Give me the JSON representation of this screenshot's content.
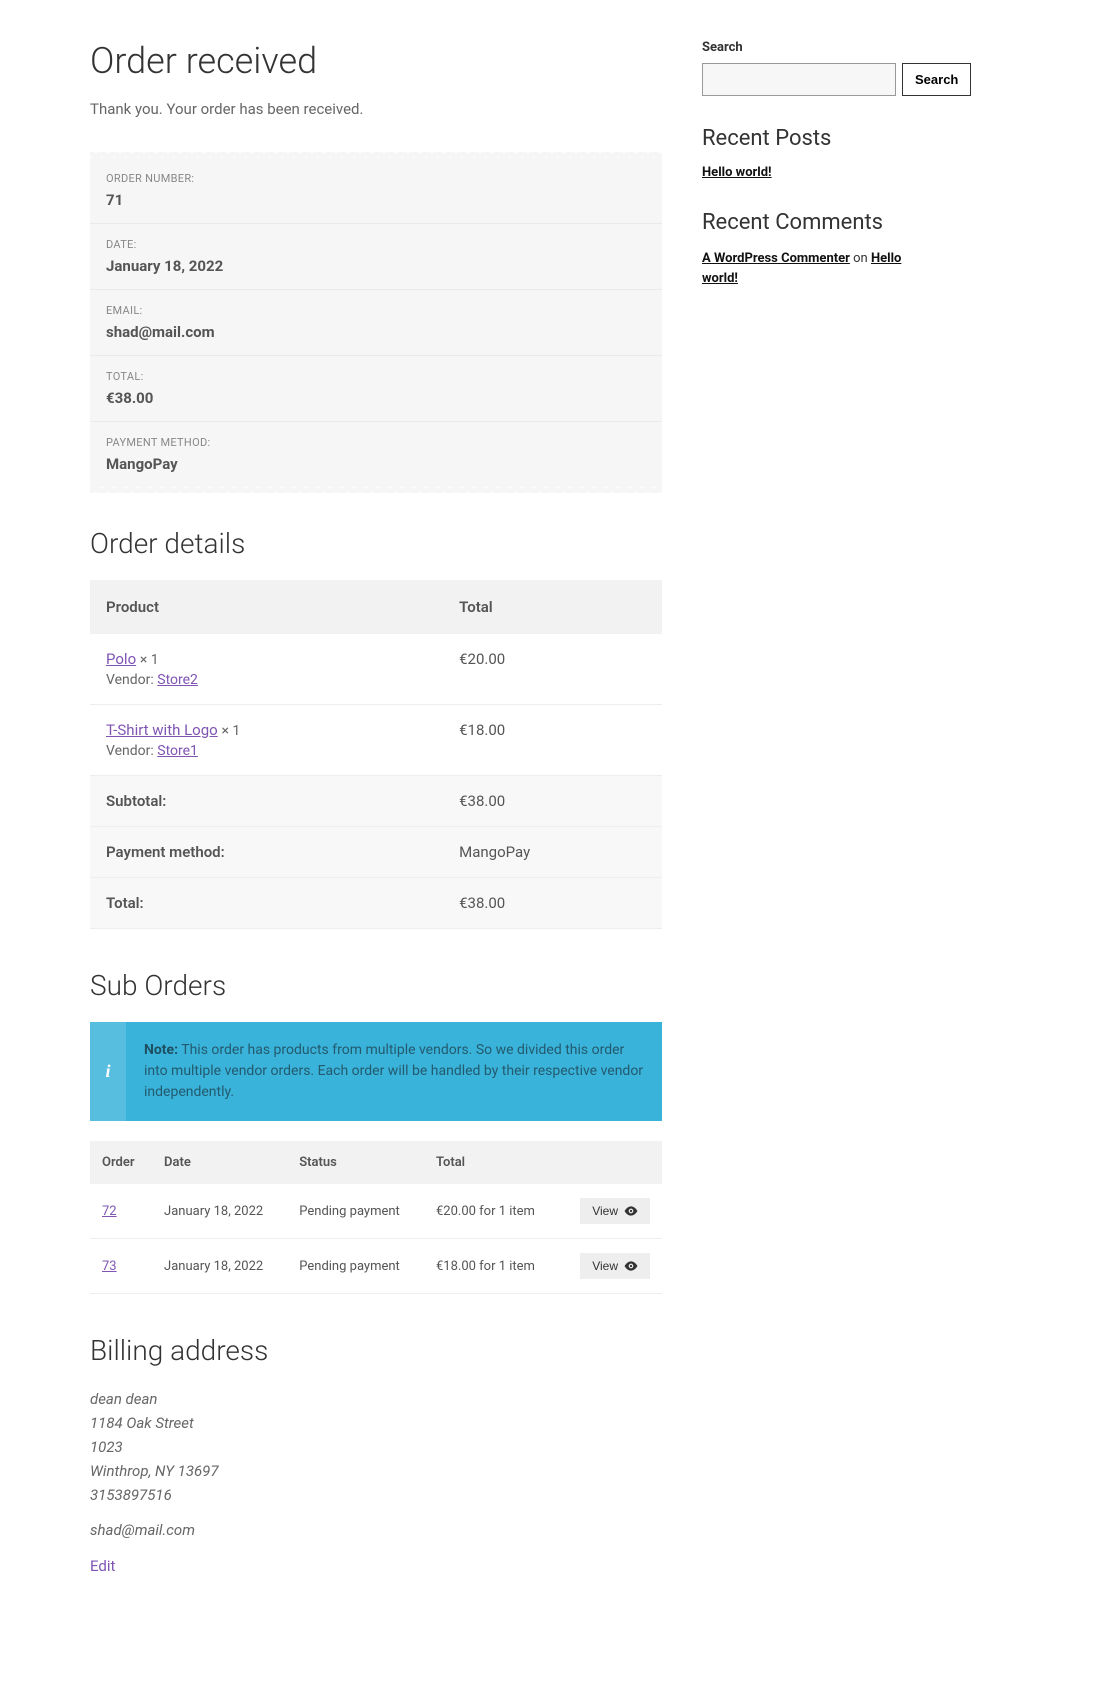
{
  "page": {
    "title": "Order received",
    "thankyou": "Thank you. Your order has been received."
  },
  "overview": [
    {
      "label": "ORDER NUMBER:",
      "value": "71"
    },
    {
      "label": "DATE:",
      "value": "January 18, 2022"
    },
    {
      "label": "EMAIL:",
      "value": "shad@mail.com"
    },
    {
      "label": "TOTAL:",
      "value": "€38.00"
    },
    {
      "label": "PAYMENT METHOD:",
      "value": "MangoPay"
    }
  ],
  "order_details": {
    "heading": "Order details",
    "headers": {
      "product": "Product",
      "total": "Total"
    },
    "items": [
      {
        "name": "Polo",
        "qty": "× 1",
        "vendor_label": "Vendor:",
        "vendor": "Store2",
        "total": "€20.00"
      },
      {
        "name": "T-Shirt with Logo",
        "qty": "× 1",
        "vendor_label": "Vendor:",
        "vendor": "Store1",
        "total": "€18.00"
      }
    ],
    "footer": [
      {
        "label": "Subtotal:",
        "value": "€38.00"
      },
      {
        "label": "Payment method:",
        "value": "MangoPay"
      },
      {
        "label": "Total:",
        "value": "€38.00"
      }
    ]
  },
  "sub_orders": {
    "heading": "Sub Orders",
    "note_label": "Note:",
    "note_text": "This order has products from multiple vendors. So we divided this order into multiple vendor orders. Each order will be handled by their respective vendor independently.",
    "headers": {
      "order": "Order",
      "date": "Date",
      "status": "Status",
      "total": "Total"
    },
    "view_label": "View",
    "rows": [
      {
        "id": "72",
        "date": "January 18, 2022",
        "status": "Pending payment",
        "total": "€20.00 for 1 item"
      },
      {
        "id": "73",
        "date": "January 18, 2022",
        "status": "Pending payment",
        "total": "€18.00 for 1 item"
      }
    ]
  },
  "billing": {
    "heading": "Billing address",
    "lines": [
      "dean dean",
      "1184 Oak Street",
      "1023",
      "Winthrop, NY 13697",
      "3153897516"
    ],
    "email": "shad@mail.com",
    "edit": "Edit"
  },
  "sidebar": {
    "search_label": "Search",
    "search_button": "Search",
    "recent_posts_heading": "Recent Posts",
    "recent_posts": [
      {
        "title": "Hello world!"
      }
    ],
    "recent_comments_heading": "Recent Comments",
    "recent_comments": [
      {
        "author": "A WordPress Commenter",
        "on": " on ",
        "post": "Hello world!"
      }
    ]
  }
}
